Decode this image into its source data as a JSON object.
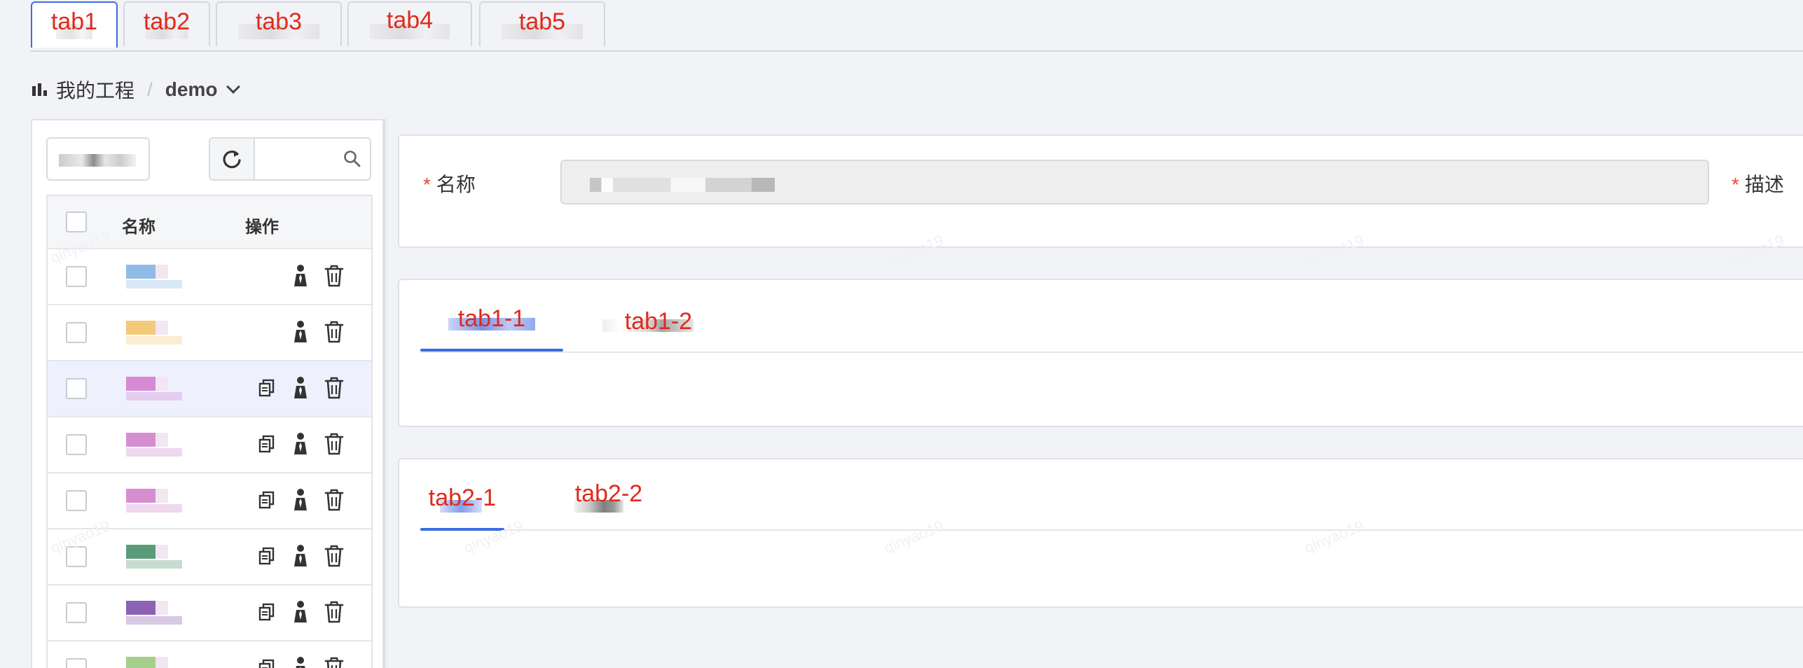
{
  "top_tabs": [
    {
      "label": "tab1",
      "active": true
    },
    {
      "label": "tab2",
      "active": false
    },
    {
      "label": "tab3",
      "active": false
    },
    {
      "label": "tab4",
      "active": false
    },
    {
      "label": "tab5",
      "active": false
    }
  ],
  "breadcrumb": {
    "root": "我的工程",
    "separator": "/",
    "current": "demo"
  },
  "table": {
    "headers": {
      "name": "名称",
      "ops": "操作"
    },
    "rows": [
      {
        "color": "#8fbce6",
        "selected": false,
        "copy_visible": false
      },
      {
        "color": "#f5c97a",
        "selected": false,
        "copy_visible": false
      },
      {
        "color": "#d78ad4",
        "selected": true,
        "copy_visible": true
      },
      {
        "color": "#d58fd0",
        "selected": false,
        "copy_visible": true
      },
      {
        "color": "#d58fd0",
        "selected": false,
        "copy_visible": true
      },
      {
        "color": "#5a9c7a",
        "selected": false,
        "copy_visible": true
      },
      {
        "color": "#8d62b3",
        "selected": false,
        "copy_visible": true
      },
      {
        "color": "#a7cf8c",
        "selected": false,
        "copy_visible": true
      }
    ]
  },
  "form": {
    "name_label": "名称",
    "desc_label": "描述",
    "required_mark": "*"
  },
  "tab_group_1": [
    {
      "label": "tab1-1",
      "active": true
    },
    {
      "label": "tab1-2",
      "active": false
    }
  ],
  "tab_group_2": [
    {
      "label": "tab2-1",
      "active": true
    },
    {
      "label": "tab2-2",
      "active": false
    }
  ],
  "watermark_text": "qinyao19",
  "colors": {
    "accent": "#3b6de1",
    "annotation_red": "#e02a1d",
    "required_red": "#e04b3c"
  }
}
